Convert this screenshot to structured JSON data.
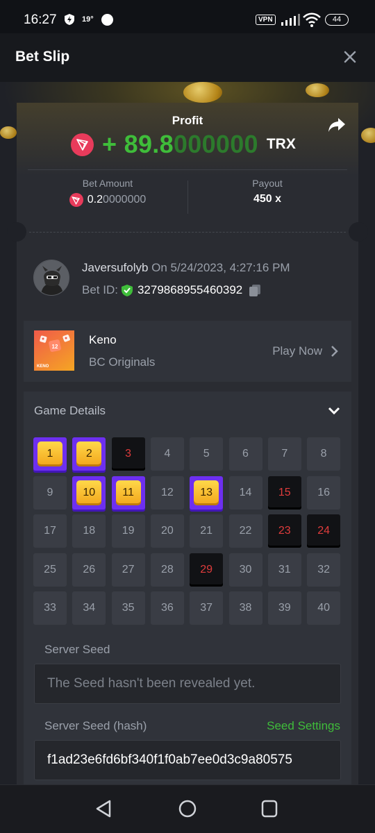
{
  "status_bar": {
    "time": "16:27",
    "temperature": "19°",
    "vpn": "VPN",
    "battery": "44"
  },
  "header": {
    "title": "Bet Slip"
  },
  "profit": {
    "label": "Profit",
    "sign": "+ ",
    "value_bright": "89.8",
    "value_dim": "000000",
    "currency": "TRX"
  },
  "bet_amount": {
    "label": "Bet Amount",
    "value_bright": "0.2",
    "value_dim": "0000000"
  },
  "payout": {
    "label": "Payout",
    "value": "450 x"
  },
  "user": {
    "name": "Javersufolyb",
    "on_text": " On 5/24/2023, 4:27:16 PM",
    "bet_id_label": "Bet ID:",
    "bet_id": "3279868955460392"
  },
  "game": {
    "name": "Keno",
    "provider": "BC Originals",
    "play_label": "Play Now",
    "thumb_number": "12",
    "thumb_text": "KENO"
  },
  "details": {
    "title": "Game Details",
    "grid": [
      {
        "n": "1",
        "s": "hit"
      },
      {
        "n": "2",
        "s": "hit"
      },
      {
        "n": "3",
        "s": "miss"
      },
      {
        "n": "4",
        "s": ""
      },
      {
        "n": "5",
        "s": ""
      },
      {
        "n": "6",
        "s": ""
      },
      {
        "n": "7",
        "s": ""
      },
      {
        "n": "8",
        "s": ""
      },
      {
        "n": "9",
        "s": ""
      },
      {
        "n": "10",
        "s": "hit"
      },
      {
        "n": "11",
        "s": "hit"
      },
      {
        "n": "12",
        "s": ""
      },
      {
        "n": "13",
        "s": "hit"
      },
      {
        "n": "14",
        "s": ""
      },
      {
        "n": "15",
        "s": "miss"
      },
      {
        "n": "16",
        "s": ""
      },
      {
        "n": "17",
        "s": ""
      },
      {
        "n": "18",
        "s": ""
      },
      {
        "n": "19",
        "s": ""
      },
      {
        "n": "20",
        "s": ""
      },
      {
        "n": "21",
        "s": ""
      },
      {
        "n": "22",
        "s": ""
      },
      {
        "n": "23",
        "s": "miss"
      },
      {
        "n": "24",
        "s": "miss"
      },
      {
        "n": "25",
        "s": ""
      },
      {
        "n": "26",
        "s": ""
      },
      {
        "n": "27",
        "s": ""
      },
      {
        "n": "28",
        "s": ""
      },
      {
        "n": "29",
        "s": "miss"
      },
      {
        "n": "30",
        "s": ""
      },
      {
        "n": "31",
        "s": ""
      },
      {
        "n": "32",
        "s": ""
      },
      {
        "n": "33",
        "s": ""
      },
      {
        "n": "34",
        "s": ""
      },
      {
        "n": "35",
        "s": ""
      },
      {
        "n": "36",
        "s": ""
      },
      {
        "n": "37",
        "s": ""
      },
      {
        "n": "38",
        "s": ""
      },
      {
        "n": "39",
        "s": ""
      },
      {
        "n": "40",
        "s": ""
      }
    ],
    "server_seed_label": "Server Seed",
    "server_seed_placeholder": "The Seed hasn't been revealed yet.",
    "server_seed_hash_label": "Server Seed (hash)",
    "seed_settings_label": "Seed Settings",
    "server_seed_hash": "f1ad23e6fd6bf340f1f0ab7ee0d3c9a80575"
  },
  "colors": {
    "profit_green": "#3fbd3a",
    "trx_red": "#e83b5b",
    "hit_purple": "#6d2ff0",
    "miss_red": "#e03c3c"
  }
}
